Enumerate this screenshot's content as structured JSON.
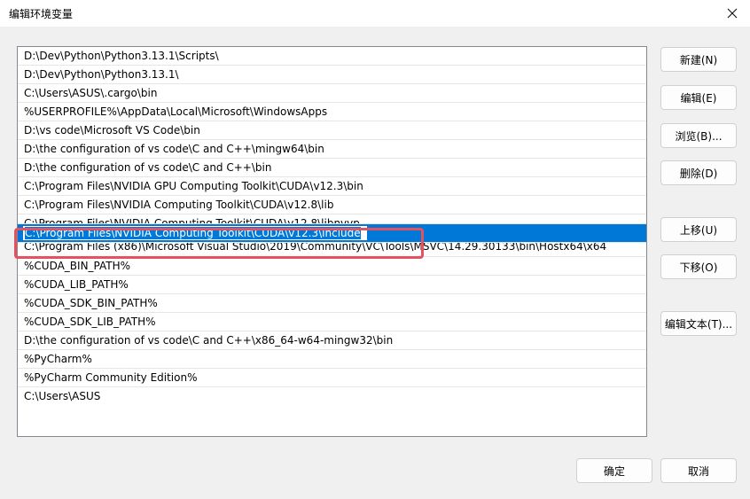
{
  "window": {
    "title": "编辑环境变量"
  },
  "list": {
    "items": [
      "D:\\Dev\\Python\\Python3.13.1\\Scripts\\",
      "D:\\Dev\\Python\\Python3.13.1\\",
      "C:\\Users\\ASUS\\.cargo\\bin",
      "%USERPROFILE%\\AppData\\Local\\Microsoft\\WindowsApps",
      "D:\\vs code\\Microsoft VS Code\\bin",
      "D:\\the configuration of vs code\\C and C++\\mingw64\\bin",
      "D:\\the configuration of vs code\\C and C++\\bin",
      "C:\\Program Files\\NVIDIA GPU Computing Toolkit\\CUDA\\v12.3\\bin",
      "C:\\Program Files\\NVIDIA Computing Toolkit\\CUDA\\v12.8\\lib",
      "C:\\Program Files\\NVIDIA Computing Toolkit\\CUDA\\v12.8\\libnvvp",
      "C:\\Program Files\\NVIDIA Computing Toolkit\\CUDA\\v12.3\\include",
      "C:\\Program Files (x86)\\Microsoft Visual Studio\\2019\\Community\\VC\\Tools\\MSVC\\14.29.30133\\bin\\Hostx64\\x64",
      "%CUDA_BIN_PATH%",
      "%CUDA_LIB_PATH%",
      "%CUDA_SDK_BIN_PATH%",
      "%CUDA_SDK_LIB_PATH%",
      "D:\\the configuration of vs code\\C and C++\\x86_64-w64-mingw32\\bin",
      "%PyCharm%",
      "%PyCharm Community Edition%",
      "C:\\Users\\ASUS"
    ],
    "selected_index": 10,
    "editing_value": "C:\\Program Files\\NVIDIA Computing Toolkit\\CUDA\\v12.3\\include"
  },
  "buttons": {
    "new": "新建(N)",
    "edit": "编辑(E)",
    "browse": "浏览(B)...",
    "delete": "删除(D)",
    "move_up": "上移(U)",
    "move_down": "下移(O)",
    "edit_text": "编辑文本(T)...",
    "ok": "确定",
    "cancel": "取消"
  },
  "colors": {
    "selection": "#0078d7",
    "annotation_box": "#e5515f"
  },
  "icons": {
    "close": "close-icon"
  }
}
